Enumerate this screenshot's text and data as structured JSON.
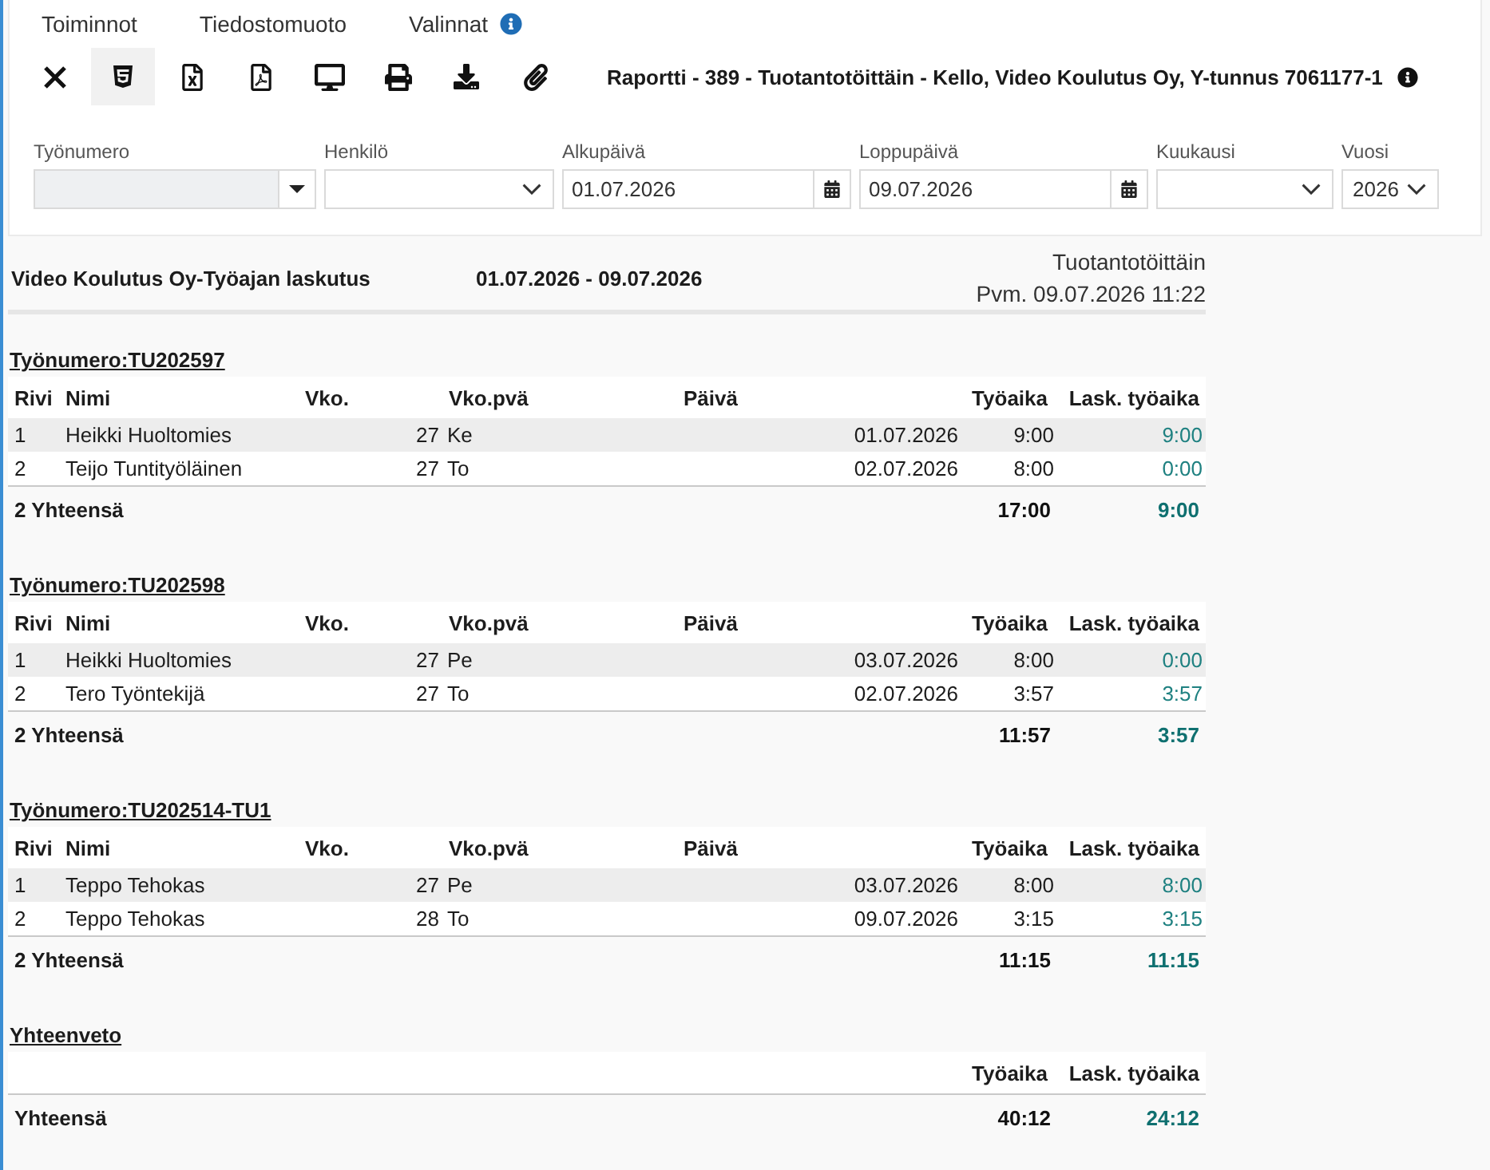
{
  "menu": [
    "Toiminnot",
    "Tiedostomuoto",
    "Valinnat"
  ],
  "toolbar": [
    {
      "kind": "close",
      "selected": false
    },
    {
      "kind": "html",
      "selected": true
    },
    {
      "kind": "excel",
      "selected": false
    },
    {
      "kind": "pdf",
      "selected": false
    },
    {
      "kind": "screen",
      "selected": false
    },
    {
      "kind": "print",
      "selected": false
    },
    {
      "kind": "download",
      "selected": false
    },
    {
      "kind": "attach",
      "selected": false
    }
  ],
  "report_title": "Raportti - 389 - Tuotantotöittäin - Kello, Video Koulutus Oy, Y-tunnus 7061177-1",
  "filters": [
    {
      "label": "Työnumero",
      "kind": "combo",
      "disabled": true
    },
    {
      "label": "Henkilö",
      "kind": "select",
      "disabled": false
    },
    {
      "label": "Alkupäivä",
      "kind": "date",
      "disabled": false,
      "value": "01.07.2026"
    },
    {
      "label": "Loppupäivä",
      "kind": "date",
      "disabled": false,
      "value": "09.07.2026"
    },
    {
      "label": "Kuukausi",
      "kind": "select",
      "disabled": false
    },
    {
      "label": "Vuosi",
      "kind": "select",
      "disabled": false,
      "value": "2026"
    }
  ],
  "report": {
    "heading": "Video Koulutus Oy-Työajan laskutus",
    "period": "01.07.2026 - 09.07.2026",
    "grouping": "Tuotantotöittäin",
    "printed": "Pvm. 09.07.2026 11:22"
  },
  "groups": [
    {
      "title": "Työnumero:TU202597",
      "columns": [
        "Rivi",
        "Nimi",
        "Vko.",
        "Vko.pvä",
        "Päivä",
        "Työaika",
        "Lask. työaika"
      ],
      "rows": [
        {
          "cells": [
            "1",
            "Heikki Huoltomies",
            "27",
            "Ke",
            "01.07.2026",
            "9:00",
            "9:00"
          ]
        },
        {
          "cells": [
            "2",
            "Teijo Tuntityöläinen",
            "27",
            "To",
            "02.07.2026",
            "8:00",
            "0:00"
          ]
        }
      ],
      "total": {
        "label": "2 Yhteensä",
        "tyoaika": "17:00",
        "lask_tyoaika": "9:00"
      }
    },
    {
      "title": "Työnumero:TU202598",
      "columns": [
        "Rivi",
        "Nimi",
        "Vko.",
        "Vko.pvä",
        "Päivä",
        "Työaika",
        "Lask. työaika"
      ],
      "rows": [
        {
          "cells": [
            "1",
            "Heikki Huoltomies",
            "27",
            "Pe",
            "03.07.2026",
            "8:00",
            "0:00"
          ]
        },
        {
          "cells": [
            "2",
            "Tero Työntekijä",
            "27",
            "To",
            "02.07.2026",
            "3:57",
            "3:57"
          ]
        }
      ],
      "total": {
        "label": "2 Yhteensä",
        "tyoaika": "11:57",
        "lask_tyoaika": "3:57"
      }
    },
    {
      "title": "Työnumero:TU202514-TU1",
      "columns": [
        "Rivi",
        "Nimi",
        "Vko.",
        "Vko.pvä",
        "Päivä",
        "Työaika",
        "Lask. työaika"
      ],
      "rows": [
        {
          "cells": [
            "1",
            "Teppo Tehokas",
            "27",
            "Pe",
            "03.07.2026",
            "8:00",
            "8:00"
          ]
        },
        {
          "cells": [
            "2",
            "Teppo Tehokas",
            "28",
            "To",
            "09.07.2026",
            "3:15",
            "3:15"
          ]
        }
      ],
      "total": {
        "label": "2 Yhteensä",
        "tyoaika": "11:15",
        "lask_tyoaika": "11:15"
      }
    }
  ],
  "summary": {
    "title": "Yhteenveto",
    "columns": [
      "Työaika",
      "Lask. työaika"
    ],
    "total": {
      "label": "Yhteensä",
      "tyoaika": "40:12",
      "lask_tyoaika": "24:12"
    }
  }
}
